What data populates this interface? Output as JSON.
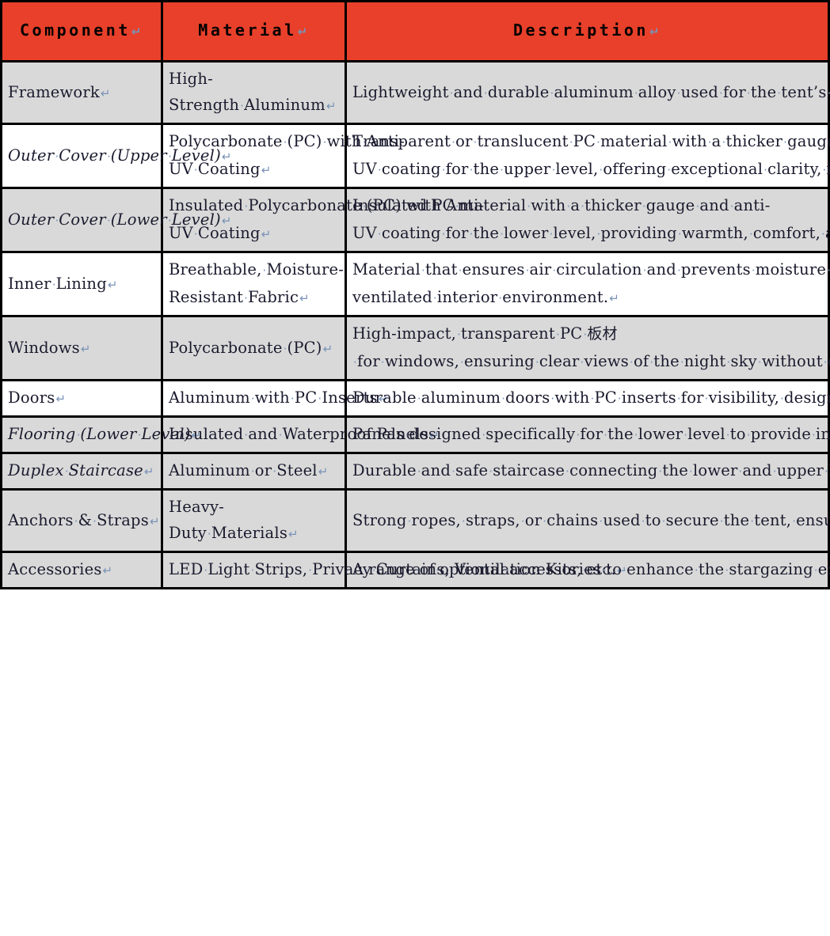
{
  "document": {
    "kind": "word-table",
    "paragraph_mark_glyph": "↵",
    "space_dot_glyph": "·",
    "colors": {
      "header_background": "#E8402A",
      "header_text": "#000000",
      "row_shaded_background": "#D9D9D9",
      "row_plain_background": "#FFFFFF",
      "border": "#000000",
      "body_text": "#1A1A2E",
      "formatting_mark": "#7A93B8"
    }
  },
  "table": {
    "headers": [
      {
        "label": "Component",
        "name": "component"
      },
      {
        "label": "Material",
        "name": "material"
      },
      {
        "label": "Description",
        "name": "description"
      }
    ],
    "rows": [
      {
        "shaded": true,
        "italic_component": false,
        "component": "Framework",
        "material": "High-Strength Aluminum",
        "description": "Lightweight and durable aluminum alloy used for the tent’s structural framework, providing stability and resistance to weather conditions."
      },
      {
        "shaded": false,
        "italic_component": true,
        "component": "Outer Cover (Upper Level)",
        "material": "Polycarbonate (PC) with Anti-UV Coating",
        "description": "Transparent or translucent PC material with a thicker gauge and anti-UV coating for the upper level, offering exceptional clarity, increased impact resistance, and protection from harmful UV rays for optimal stargazing."
      },
      {
        "shaded": true,
        "italic_component": true,
        "component": "Outer Cover (Lower Level)",
        "material": "Insulated Polycarbonate (PC) with Anti-UV Coating",
        "description": "Insulated PC material with a thicker gauge and anti-UV coating for the lower level, providing warmth, comfort, and increased impact resistance, with an option for transparency for natural light."
      },
      {
        "shaded": false,
        "italic_component": false,
        "component": "Inner Lining",
        "material": "Breathable, Moisture-Resistant Fabric",
        "description": "Material that ensures air circulation and prevents moisture buildup, contributing to a comfortable and well-ventilated interior environment."
      },
      {
        "shaded": true,
        "italic_component": false,
        "component": "Windows",
        "material": "Polycarbonate (PC)",
        "description": "High-impact, transparent PC 板材 for windows, ensuring clear views of the night sky without compromising on safety and durability."
      },
      {
        "shaded": false,
        "italic_component": false,
        "component": "Doors",
        "material": "Aluminum with PC Inserts",
        "description": "Durable aluminum doors with PC inserts for visibility, designed for easy access and security."
      },
      {
        "shaded": true,
        "italic_component": true,
        "component": "Flooring (Lower Level)",
        "material": "Insulated and Waterproof Panels",
        "description": "Panels designed specifically for the lower level to provide insulation from the cold and protect against moisture, ensuring a comfortable and dry interior."
      },
      {
        "shaded": true,
        "italic_component": true,
        "component": "Duplex Staircase",
        "material": "Aluminum or Steel",
        "description": "Durable and safe staircase connecting the lower and upper levels, designed for easy and secure access to the upper observation deck."
      },
      {
        "shaded": true,
        "italic_component": false,
        "component": "Anchors & Straps",
        "material": "Heavy-Duty Materials",
        "description": "Strong ropes, straps, or chains used to secure the tent, ensuring stability in various weather conditions."
      },
      {
        "shaded": true,
        "italic_component": false,
        "component": "Accessories",
        "material": "LED Light Strips, Privacy Curtains, Ventilation Kits, etc.",
        "description": "A range of optional accessories to enhance the stargazing experience, provide comfort, and customize the tent to personal preferences."
      }
    ]
  }
}
